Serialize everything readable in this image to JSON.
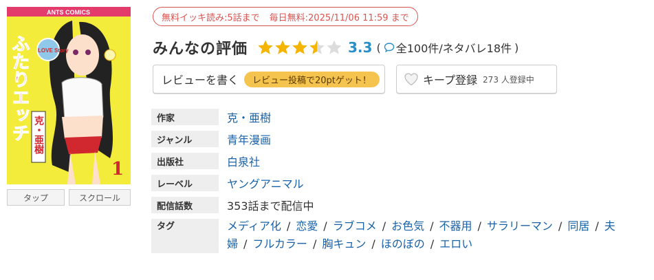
{
  "campaign": {
    "free_read": "無料イッキ読み:5話まで",
    "daily_free": "毎日無料:2025/11/06 11:59 まで"
  },
  "rating": {
    "title": "みんなの評価",
    "score": "3.3",
    "stars": 3.5,
    "count_text": "全100件/ネタバレ18件",
    "open_paren": "(",
    "close_paren": ")"
  },
  "actions": {
    "review_label": "レビューを書く",
    "review_promo": "レビュー投稿で20ptゲット！",
    "keep_label": "キープ登録",
    "keep_count": "273 人登録中"
  },
  "reader_modes": [
    "タップ",
    "スクロール"
  ],
  "info": {
    "author_label": "作家",
    "author": "克・亜樹",
    "genre_label": "ジャンル",
    "genre": "青年漫画",
    "publisher_label": "出版社",
    "publisher": "白泉社",
    "label_label": "レーベル",
    "label": "ヤングアニマル",
    "episodes_label": "配信話数",
    "episodes": "353話まで配信中",
    "tags_label": "タグ",
    "tags": [
      "メディア化",
      "恋愛",
      "ラブコメ",
      "お色気",
      "不器用",
      "サラリーマン",
      "同居",
      "夫婦",
      "フルカラー",
      "胸キュン",
      "ほのぼの",
      "エロい"
    ],
    "tag_separator": "/"
  },
  "cover": {
    "series_mark": "ANTS COMICS",
    "title_art": "ふたりエッチ",
    "badge": "LOVE Story",
    "author_mark": "克・亜樹",
    "volume": "1"
  },
  "colors": {
    "accent_blue": "#2a8fc6",
    "link": "#1a62a8",
    "campaign_red": "#d9534f",
    "promo_yellow": "#f4c44e",
    "star": "#f4b400"
  }
}
